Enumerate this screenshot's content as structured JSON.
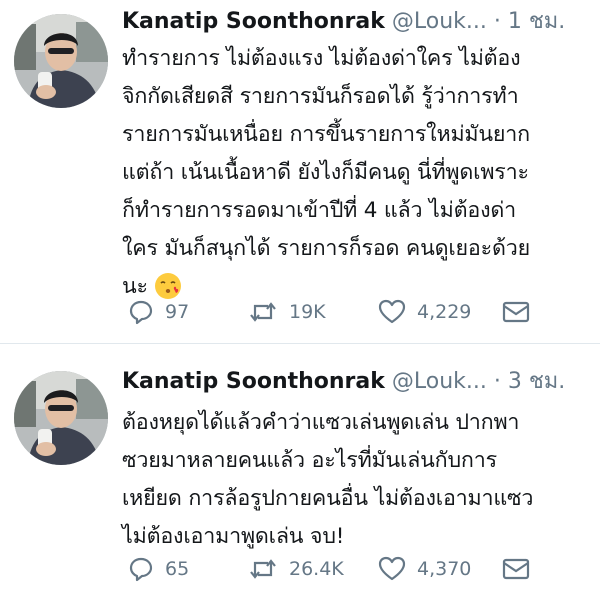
{
  "tweets": [
    {
      "author_name": "Kanatip Soonthonrak",
      "handle": "@Louk...",
      "time": "· 1 ชม.",
      "text": "ทำรายการ ไม่ต้องแรง ไม่ต้องด่าใคร ไม่ต้อง\nจิกกัดเสียดสี รายการมันก็รอดได้ รู้ว่าการทำ\nรายการมันเหนื่อย การขึ้นรายการใหม่มันยาก\nแต่ถ้า เน้นเนื้อหาดี ยังไงก็มีคนดู นี่ที่พูดเพราะ\nก็ทำรายการรอดมาเข้าปีที่ 4 แล้ว ไม่ต้องด่า\nใคร มันก็สนุกได้ รายการก็รอด คนดูเยอะด้วย\nนะ",
      "emoji": "kissing-face-emoji",
      "replies": "97",
      "retweets": "19K",
      "likes": "4,229"
    },
    {
      "author_name": "Kanatip Soonthonrak",
      "handle": "@Louk...",
      "time": "· 3 ชม.",
      "text": "ต้องหยุดได้แล้วคำว่าแซวเล่นพูดเล่น ปากพา\nซวยมาหลายคนแล้ว อะไรที่มันเล่นกับการ\nเหยียด การล้อรูปกายคนอื่น ไม่ต้องเอามาแซว\nไม่ต้องเอามาพูดเล่น จบ!",
      "replies": "65",
      "retweets": "26.4K",
      "likes": "4,370"
    }
  ],
  "colors": {
    "text_primary": "#14171a",
    "text_secondary": "#657786",
    "icon": "#657786",
    "divider": "#e1e8ed"
  }
}
